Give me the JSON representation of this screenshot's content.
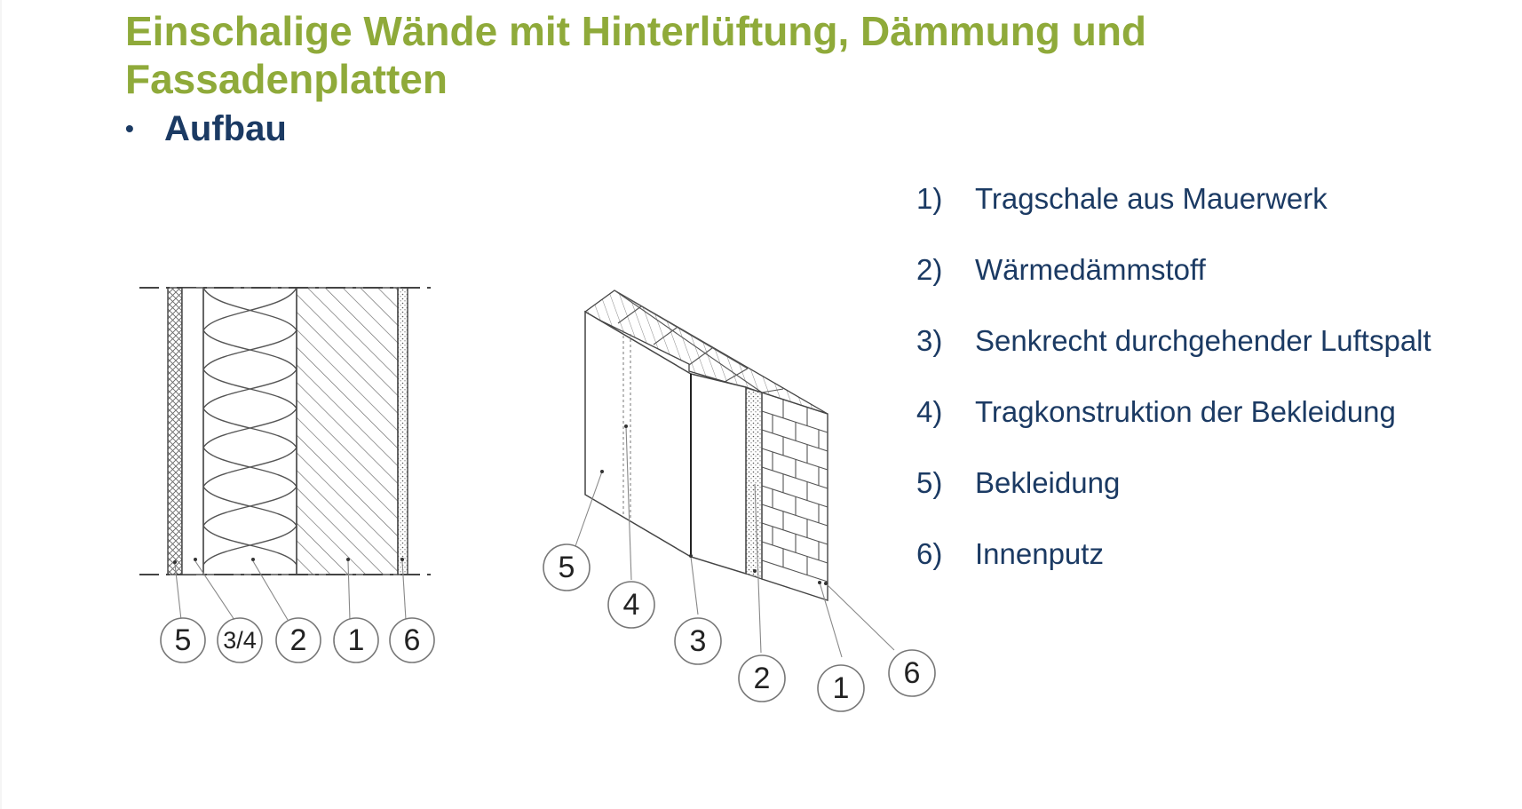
{
  "title": "Einschalige Wände mit Hinterlüftung, Dämmung und Fassadenplatten",
  "bullet": "Aufbau",
  "bullet_marker": "•",
  "legend": [
    {
      "num": "1)",
      "text": "Tragschale aus Mauerwerk"
    },
    {
      "num": "2)",
      "text": "Wärmedämmstoff"
    },
    {
      "num": "3)",
      "text": "Senkrecht durchgehender Luftspalt"
    },
    {
      "num": "4)",
      "text": "Tragkonstruktion der Bekleidung"
    },
    {
      "num": "5)",
      "text": "Bekleidung"
    },
    {
      "num": "6)",
      "text": "Innenputz"
    }
  ],
  "section_callouts": [
    "5",
    "3/4",
    "2",
    "1",
    "6"
  ],
  "iso_callouts": [
    "5",
    "4",
    "3",
    "2",
    "1",
    "6"
  ],
  "colors": {
    "title": "#8faa3a",
    "text": "#1b3a63",
    "line": "#555555"
  }
}
